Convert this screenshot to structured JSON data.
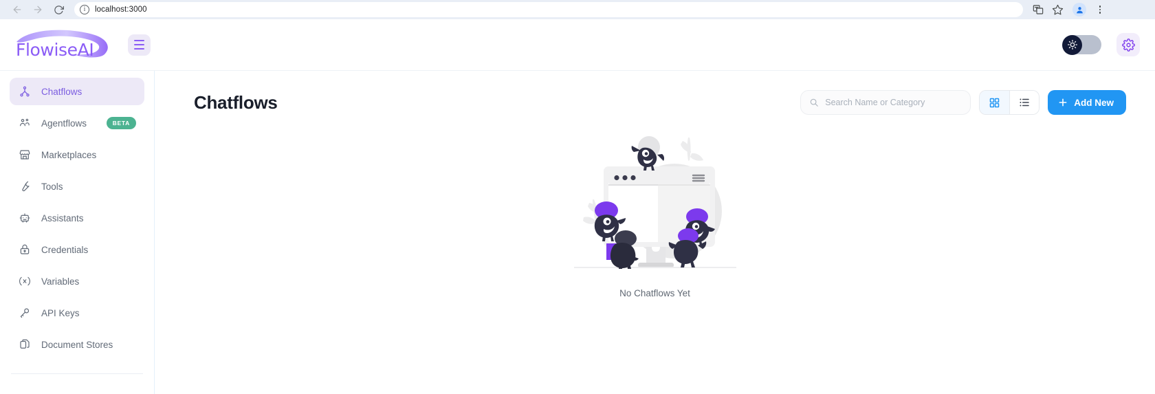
{
  "browser": {
    "back_icon": "arrow-left-icon",
    "forward_icon": "arrow-right-icon",
    "reload_icon": "reload-icon",
    "site_info_icon": "info-icon",
    "url": "localhost:3000",
    "translate_icon": "translate-icon",
    "bookmark_icon": "star-icon",
    "profile_icon": "avatar-icon",
    "menu_icon": "kebab-menu-icon"
  },
  "header": {
    "logo_text": "FlowiseAI",
    "menu_toggle_icon": "hamburger-icon",
    "theme_toggle": {
      "icon": "sun-icon",
      "state": "light"
    },
    "settings_icon": "gear-icon"
  },
  "sidebar": {
    "items": [
      {
        "label": "Chatflows",
        "icon": "sitemap-icon",
        "active": true,
        "badge": ""
      },
      {
        "label": "Agentflows",
        "icon": "users-group-icon",
        "active": false,
        "badge": "BETA"
      },
      {
        "label": "Marketplaces",
        "icon": "building-store-icon",
        "active": false,
        "badge": ""
      },
      {
        "label": "Tools",
        "icon": "wrench-icon",
        "active": false,
        "badge": ""
      },
      {
        "label": "Assistants",
        "icon": "robot-icon",
        "active": false,
        "badge": ""
      },
      {
        "label": "Credentials",
        "icon": "lock-icon",
        "active": false,
        "badge": ""
      },
      {
        "label": "Variables",
        "icon": "variable-icon",
        "active": false,
        "badge": ""
      },
      {
        "label": "API Keys",
        "icon": "key-icon",
        "active": false,
        "badge": ""
      },
      {
        "label": "Document Stores",
        "icon": "files-icon",
        "active": false,
        "badge": ""
      }
    ]
  },
  "main": {
    "page_title": "Chatflows",
    "search": {
      "placeholder": "Search Name or Category",
      "value": "",
      "icon": "search-icon"
    },
    "view_toggle": {
      "grid_icon": "grid-view-icon",
      "list_icon": "list-view-icon",
      "active": "grid"
    },
    "add_button": {
      "label": "Add New",
      "icon": "plus-icon"
    },
    "empty_state": {
      "text": "No Chatflows Yet",
      "illustration": "empty-monitor-monsters-illustration"
    }
  },
  "colors": {
    "brand_purple": "#8b5cf6",
    "accent_blue": "#2196f3",
    "beta_green": "#4cb391",
    "sidebar_active_bg": "#ede9f7",
    "monster_dark": "#2f3045",
    "monster_purple": "#7c3aed"
  }
}
